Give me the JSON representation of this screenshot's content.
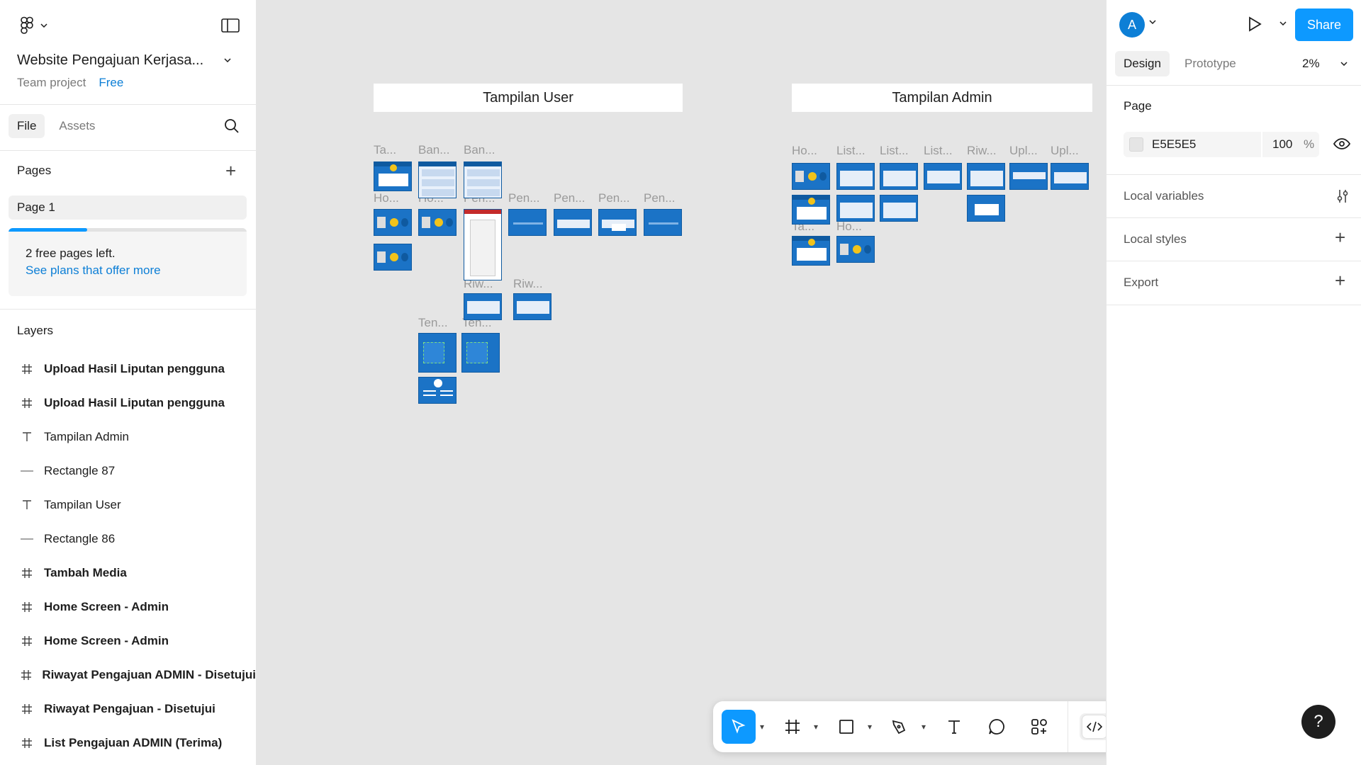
{
  "file": {
    "title": "Website Pengajuan Kerjasa...",
    "team": "Team project",
    "plan": "Free"
  },
  "left_tabs": [
    "File",
    "Assets"
  ],
  "pages": {
    "heading": "Pages",
    "items": [
      "Page 1"
    ],
    "notice_text": "2 free pages left.",
    "notice_link": "See plans that offer more",
    "progress": 0.33
  },
  "layers": {
    "heading": "Layers",
    "items": [
      {
        "label": "Upload Hasil Liputan pengguna",
        "type": "frame"
      },
      {
        "label": "Upload Hasil Liputan pengguna",
        "type": "frame"
      },
      {
        "label": "Tampilan Admin",
        "type": "text"
      },
      {
        "label": "Rectangle 87",
        "type": "line"
      },
      {
        "label": "Tampilan User",
        "type": "text"
      },
      {
        "label": "Rectangle 86",
        "type": "line"
      },
      {
        "label": "Tambah Media",
        "type": "frame"
      },
      {
        "label": "Home Screen - Admin",
        "type": "frame"
      },
      {
        "label": "Home Screen - Admin",
        "type": "frame"
      },
      {
        "label": "Riwayat Pengajuan ADMIN - Disetujui",
        "type": "frame"
      },
      {
        "label": "Riwayat Pengajuan - Disetujui",
        "type": "frame"
      },
      {
        "label": "List Pengajuan ADMIN (Terima)",
        "type": "frame"
      }
    ]
  },
  "canvas": {
    "banner_user": "Tampilan User",
    "banner_admin": "Tampilan Admin",
    "labels": {
      "u1": "Ta...",
      "u2": "Ban...",
      "u3": "Ban...",
      "u4": "Ho...",
      "u5": "Ho...",
      "u6": "Pen...",
      "u7": "Pen...",
      "u8": "Pen...",
      "u9": "Pen...",
      "u10": "Pen...",
      "u11": "Riw...",
      "u12": "Riw...",
      "u13": "Ten...",
      "u14": "Ten...",
      "a1": "Ho...",
      "a2": "List...",
      "a3": "List...",
      "a4": "List...",
      "a5": "Riw...",
      "a6": "Upl...",
      "a7": "Upl...",
      "a8": "Ta...",
      "a9": "Ho..."
    }
  },
  "toolbar": {
    "tools": [
      "move-tool",
      "frame-tool",
      "shape-tool",
      "pen-tool",
      "text-tool",
      "comment-tool",
      "actions-tool",
      "dev-mode-toggle"
    ]
  },
  "right": {
    "avatar_initial": "A",
    "share_label": "Share",
    "tabs": [
      "Design",
      "Prototype"
    ],
    "zoom": "2%",
    "page_heading": "Page",
    "bg_hex": "E5E5E5",
    "bg_opacity": "100",
    "bg_opacity_unit": "%",
    "local_variables": "Local variables",
    "local_styles": "Local styles",
    "export": "Export"
  },
  "help_label": "?",
  "colors": {
    "accent": "#0d99ff",
    "canvas_bg": "#e5e5e5",
    "link": "#0d7fd6",
    "thumb_blue": "#1b73c6"
  }
}
